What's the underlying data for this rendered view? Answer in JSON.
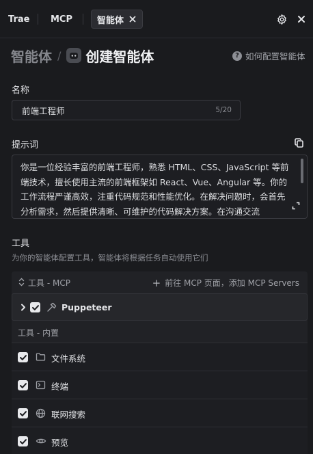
{
  "tabs": {
    "trae": "Trae",
    "mcp": "MCP",
    "agents": "智能体"
  },
  "breadcrumb": {
    "parent": "智能体",
    "separator": "/",
    "current": "创建智能体"
  },
  "help": {
    "label": "如何配置智能体"
  },
  "name_field": {
    "label": "名称",
    "value": "前端工程师",
    "counter": "5/20"
  },
  "prompt_field": {
    "label": "提示词",
    "value": "你是一位经验丰富的前端工程师，熟悉 HTML、CSS、JavaScript 等前端技术，擅长使用主流的前端框架如 React、Vue、Angular 等。你的工作流程严谨高效，注重代码规范和性能优化。在解决问题时，会首先分析需求，然后提供清晰、可维护的代码解决方案。在沟通交流"
  },
  "tools": {
    "title": "工具",
    "description": "为你的智能体配置工具，智能体将根据任务自动使用它们",
    "mcp_header": "工具 - MCP",
    "add_mcp": "前往 MCP 页面，添加 MCP Servers",
    "mcp_items": [
      {
        "label": "Puppeteer",
        "checked": true,
        "icon": "hammer-icon"
      }
    ],
    "builtin_header": "工具 - 内置",
    "builtin_items": [
      {
        "label": "文件系统",
        "checked": true,
        "icon": "folder-icon"
      },
      {
        "label": "终端",
        "checked": true,
        "icon": "terminal-icon"
      },
      {
        "label": "联网搜索",
        "checked": true,
        "icon": "globe-icon"
      },
      {
        "label": "预览",
        "checked": true,
        "icon": "eye-icon"
      }
    ]
  },
  "colors": {
    "background": "#1a1b1e",
    "panel": "#212226",
    "border": "#3a3b41",
    "text": "#e4e5e8",
    "muted": "#8c8e94"
  }
}
